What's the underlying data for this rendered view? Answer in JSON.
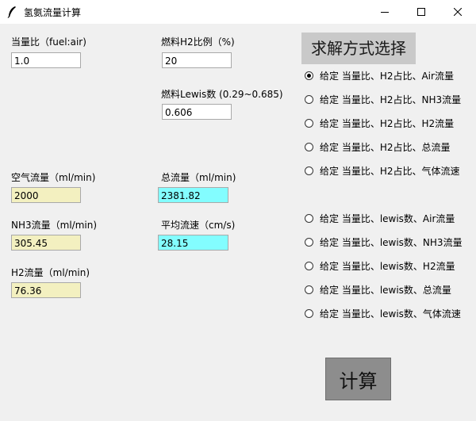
{
  "window": {
    "title": "氢氨流量计算",
    "icon": "feather-icon",
    "controls": [
      "minimize-icon",
      "maximize-icon",
      "close-icon"
    ]
  },
  "form": {
    "equivalence_ratio": {
      "label": "当量比（fuel:air)",
      "value": "1.0"
    },
    "h2_ratio": {
      "label": "燃料H2比例（%)",
      "value": "20"
    },
    "lewis": {
      "label": "燃料Lewis数 (0.29~0.685)",
      "value": "0.606"
    },
    "air_flow": {
      "label": "空气流量（ml/min)",
      "value": "2000"
    },
    "total_flow": {
      "label": "总流量（ml/min)",
      "value": "2381.82"
    },
    "nh3_flow": {
      "label": "NH3流量（ml/min)",
      "value": "305.45"
    },
    "avg_velocity": {
      "label": "平均流速（cm/s)",
      "value": "28.15"
    },
    "h2_flow": {
      "label": "H2流量（ml/min)",
      "value": "76.36"
    }
  },
  "method": {
    "title": "求解方式选择",
    "selected_index": 0,
    "options": [
      "给定 当量比、H2占比、Air流量",
      "给定 当量比、H2占比、NH3流量",
      "给定 当量比、H2占比、H2流量",
      "给定 当量比、H2占比、总流量",
      "给定 当量比、H2占比、气体流速",
      "给定 当量比、lewis数、Air流量",
      "给定 当量比、lewis数、NH3流量",
      "给定 当量比、lewis数、H2流量",
      "给定 当量比、lewis数、总流量",
      "给定 当量比、lewis数、气体流速"
    ]
  },
  "actions": {
    "calculate_label": "计算"
  },
  "colors": {
    "background": "#f0f0f0",
    "input_white": "#ffffff",
    "input_yellow": "#f3f0c0",
    "input_cyan": "#83fdff",
    "method_title_bg": "#c9c9c9",
    "calculate_bg": "#8d8d8d"
  }
}
